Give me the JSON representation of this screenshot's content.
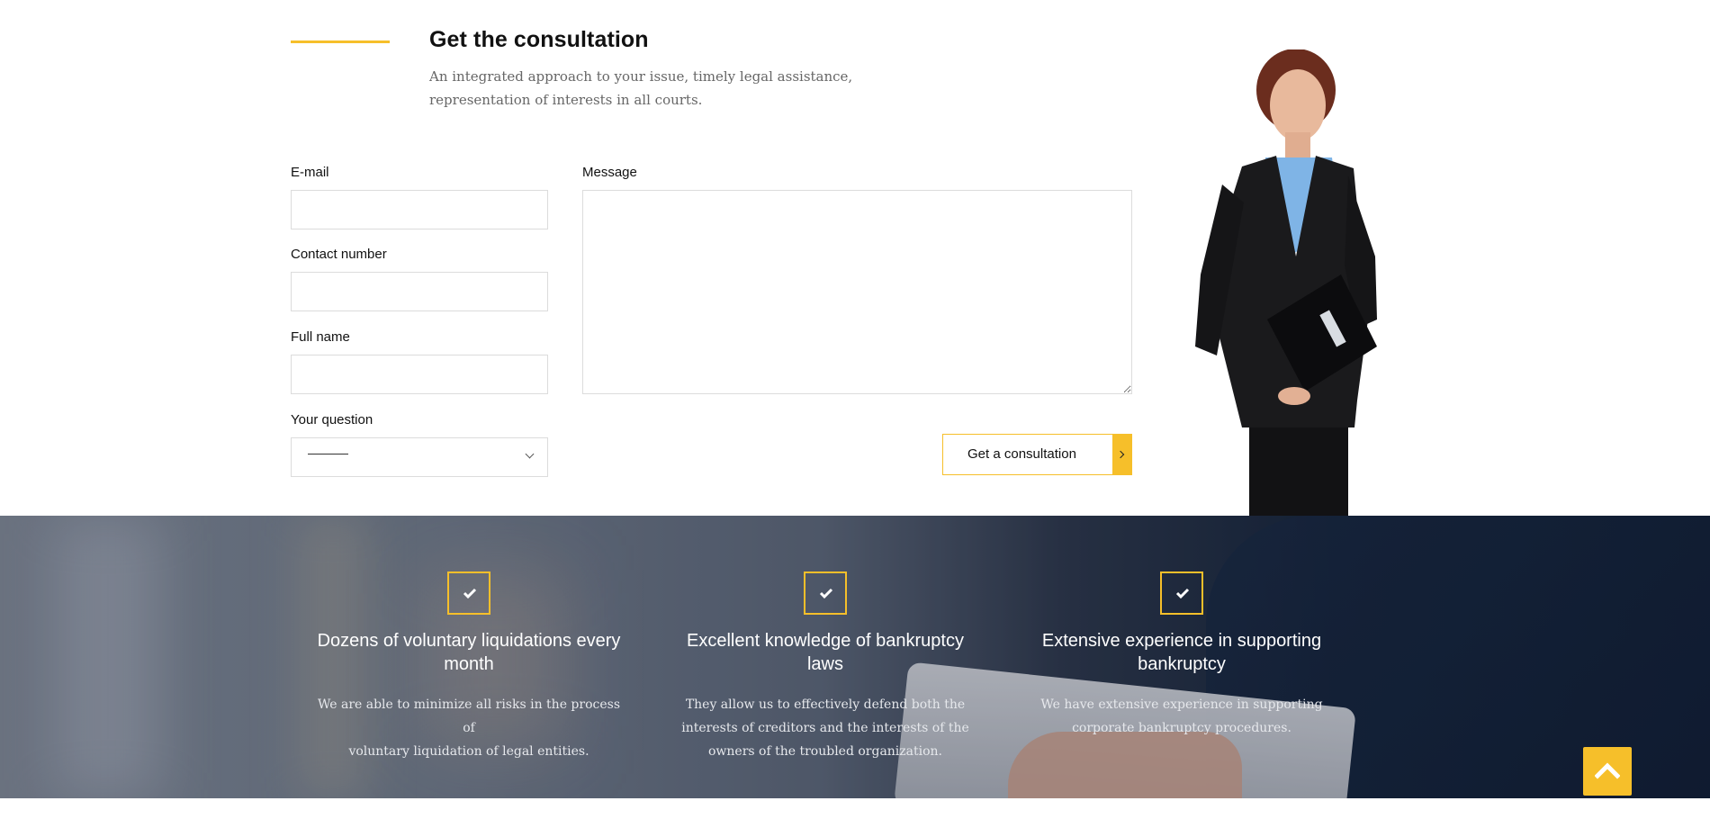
{
  "header": {
    "title": "Get the consultation",
    "subtitle_line1": "An integrated approach to your issue, timely legal assistance,",
    "subtitle_line2": "representation of interests in all courts."
  },
  "form": {
    "email_label": "E-mail",
    "email_value": "",
    "phone_label": "Contact number",
    "phone_value": "",
    "name_label": "Full name",
    "name_value": "",
    "question_label": "Your question",
    "question_selected": "———",
    "message_label": "Message",
    "message_value": "",
    "submit_label": "Get a consultation"
  },
  "features": [
    {
      "icon": "check-icon",
      "title_line1": "Dozens of voluntary liquidations every",
      "title_line2": "month",
      "text_line1": "We are able to minimize all risks in the process of",
      "text_line2": "voluntary liquidation of legal entities.",
      "text_line3": ""
    },
    {
      "icon": "check-icon",
      "title_line1": "Excellent knowledge of bankruptcy",
      "title_line2": "laws",
      "text_line1": "They allow us to effectively defend both the",
      "text_line2": "interests of creditors and the interests of the",
      "text_line3": "owners of the troubled organization."
    },
    {
      "icon": "check-icon",
      "title_line1": "Extensive experience in supporting",
      "title_line2": "bankruptcy",
      "text_line1": "We have extensive experience in supporting",
      "text_line2": "corporate bankruptcy procedures.",
      "text_line3": ""
    }
  ],
  "colors": {
    "accent": "#f6bf2a",
    "text": "#111111",
    "muted": "#666666",
    "border": "#dcdcdc"
  },
  "scroll_top": {
    "icon": "chevron-up-icon"
  }
}
